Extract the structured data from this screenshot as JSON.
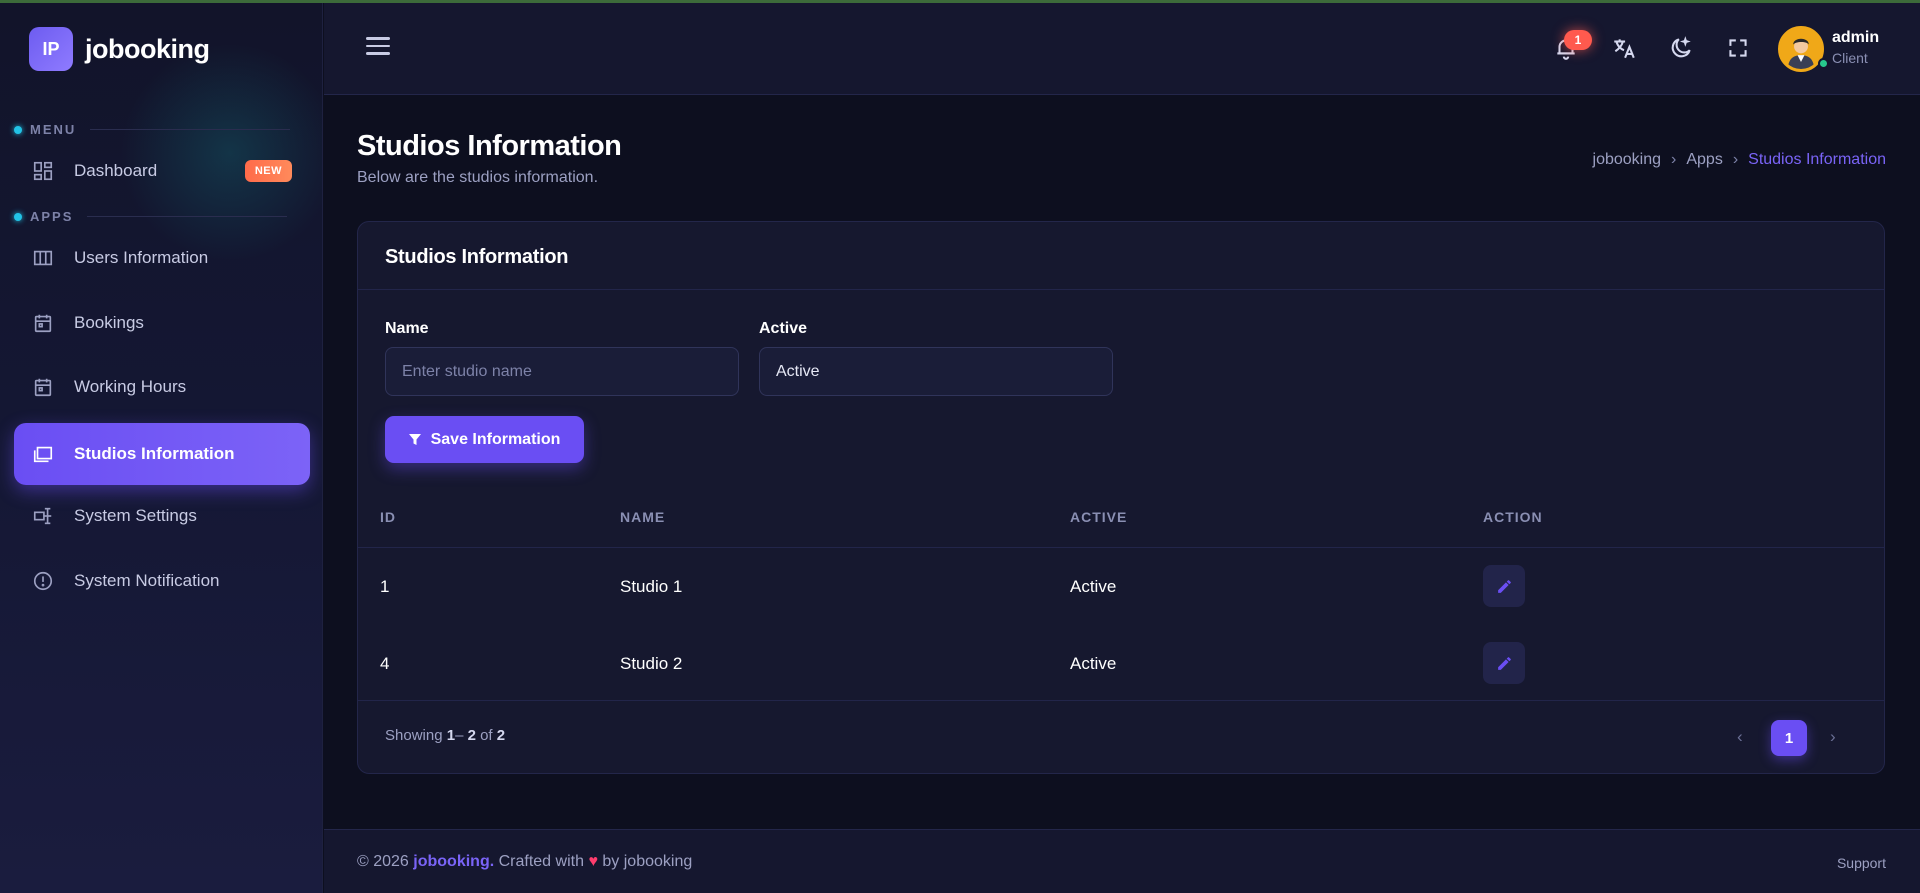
{
  "app": {
    "brand_initials": "IP",
    "brand_name": "jobooking"
  },
  "sidebar": {
    "sections": [
      {
        "label": "MENU"
      },
      {
        "label": "APPS"
      }
    ],
    "items": [
      {
        "label": "Dashboard",
        "icon": "dashboard-icon",
        "badge": "NEW"
      },
      {
        "label": "Users Information",
        "icon": "columns-icon"
      },
      {
        "label": "Bookings",
        "icon": "calendar-icon"
      },
      {
        "label": "Working Hours",
        "icon": "calendar-icon"
      },
      {
        "label": "Studios Information",
        "icon": "folders-icon",
        "active": true
      },
      {
        "label": "System Settings",
        "icon": "settings-icon"
      },
      {
        "label": "System Notification",
        "icon": "alert-circle-icon"
      }
    ]
  },
  "header": {
    "notification_count": "1",
    "user": {
      "name": "admin",
      "role": "Client"
    }
  },
  "page": {
    "title": "Studios Information",
    "subtitle": "Below are the studios information.",
    "breadcrumb": [
      "jobooking",
      "Apps",
      "Studios Information"
    ]
  },
  "card": {
    "title": "Studios Information",
    "form": {
      "name_label": "Name",
      "name_placeholder": "Enter studio name",
      "name_value": "",
      "active_label": "Active",
      "active_value": "Active",
      "save_label": "Save Information"
    },
    "table": {
      "columns": [
        "ID",
        "NAME",
        "ACTIVE",
        "ACTION"
      ],
      "rows": [
        {
          "id": "1",
          "name": "Studio 1",
          "active": "Active"
        },
        {
          "id": "4",
          "name": "Studio 2",
          "active": "Active"
        }
      ]
    },
    "pagination": {
      "showing_prefix": "Showing",
      "range_start": "1",
      "range_sep": "– ",
      "range_end": "2",
      "of": "of",
      "total": "2",
      "current_page": "1",
      "prev": "‹",
      "next": "›"
    }
  },
  "footer": {
    "year": "© 2026",
    "brand": "jobooking.",
    "crafted": "Crafted with",
    "heart": "♥",
    "by": "by jobooking",
    "support": "Support"
  },
  "colors": {
    "accent": "#6a4ef3",
    "background": "#0d0f1f",
    "badge": "#ff6b4a"
  }
}
